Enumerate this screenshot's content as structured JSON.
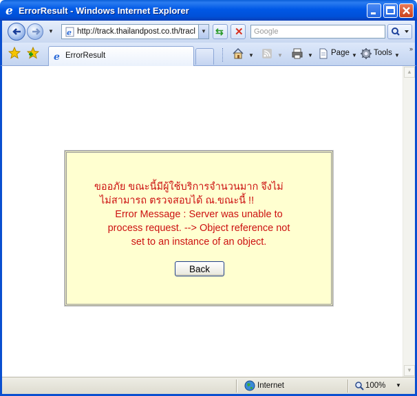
{
  "window": {
    "title": "ErrorResult - Windows Internet Explorer"
  },
  "navbar": {
    "address": "http://track.thailandpost.co.th/tracl",
    "search_placeholder": "Google"
  },
  "tab": {
    "label": "ErrorResult"
  },
  "commandbar": {
    "page_label": "Page",
    "tools_label": "Tools"
  },
  "error": {
    "thai_line1": "ขออภัย ขณะนี้มีผู้ใช้บริการจำนวนมาก จึงไม่",
    "thai_line2": "ไม่สามารถ ตรวจสอบได้ ณ.ขณะนี้ !!",
    "message_line1": "Error Message : Server was unable to",
    "message_line2": "process request. --> Object reference not",
    "message_line3": "set to an instance of an object.",
    "back_label": "Back"
  },
  "statusbar": {
    "zone": "Internet",
    "zoom": "100%"
  },
  "colors": {
    "titlebar": "#0058e6",
    "error_text": "#cc1010",
    "error_box_bg": "#ffffd0"
  }
}
